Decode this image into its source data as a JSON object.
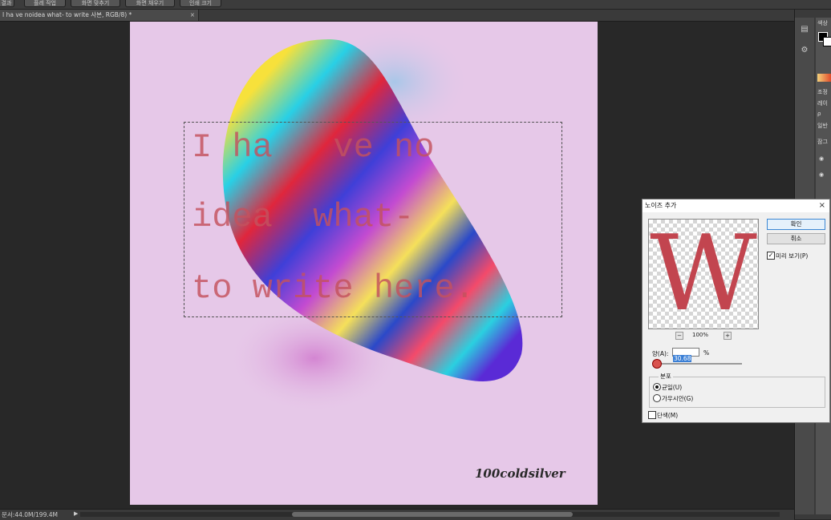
{
  "topbar": {
    "items": [
      "결과",
      "플레 작업",
      "화면 맞추기",
      "화면 채우기",
      "인쇄 크기"
    ]
  },
  "document_tab": {
    "title": "I ha   ve noidea   what- to write 사본, RGB/8) *",
    "close": "×"
  },
  "canvas": {
    "background": "#e6c8e8",
    "text_color": "#c4525e",
    "lines": [
      "I ha   ve no",
      "idea  what-",
      "to write here."
    ],
    "signature": "100coldsilver"
  },
  "status": {
    "doc_size": "문서:44.0M/199.4M",
    "arrow": "▶"
  },
  "right_panel": {
    "labels": [
      "색상",
      "조정",
      "레이",
      "ρ",
      "일반",
      "잠그"
    ]
  },
  "dialog": {
    "title": "노이즈 추가",
    "close": "×",
    "ok_label": "확인",
    "cancel_label": "취소",
    "preview_label": "미리 보기(P)",
    "preview_checked": true,
    "preview_glyph": "W",
    "zoom_minus": "−",
    "zoom_plus": "+",
    "zoom_percent": "100%",
    "amount_label": "양(A):",
    "amount_value": "30.68",
    "amount_unit": "%",
    "distribution_label": "분포",
    "uniform_label": "균일(U)",
    "gaussian_label": "가우시안(G)",
    "monochromatic_label": "단색(M)",
    "selected_distribution": "uniform",
    "monochromatic_checked": false
  }
}
